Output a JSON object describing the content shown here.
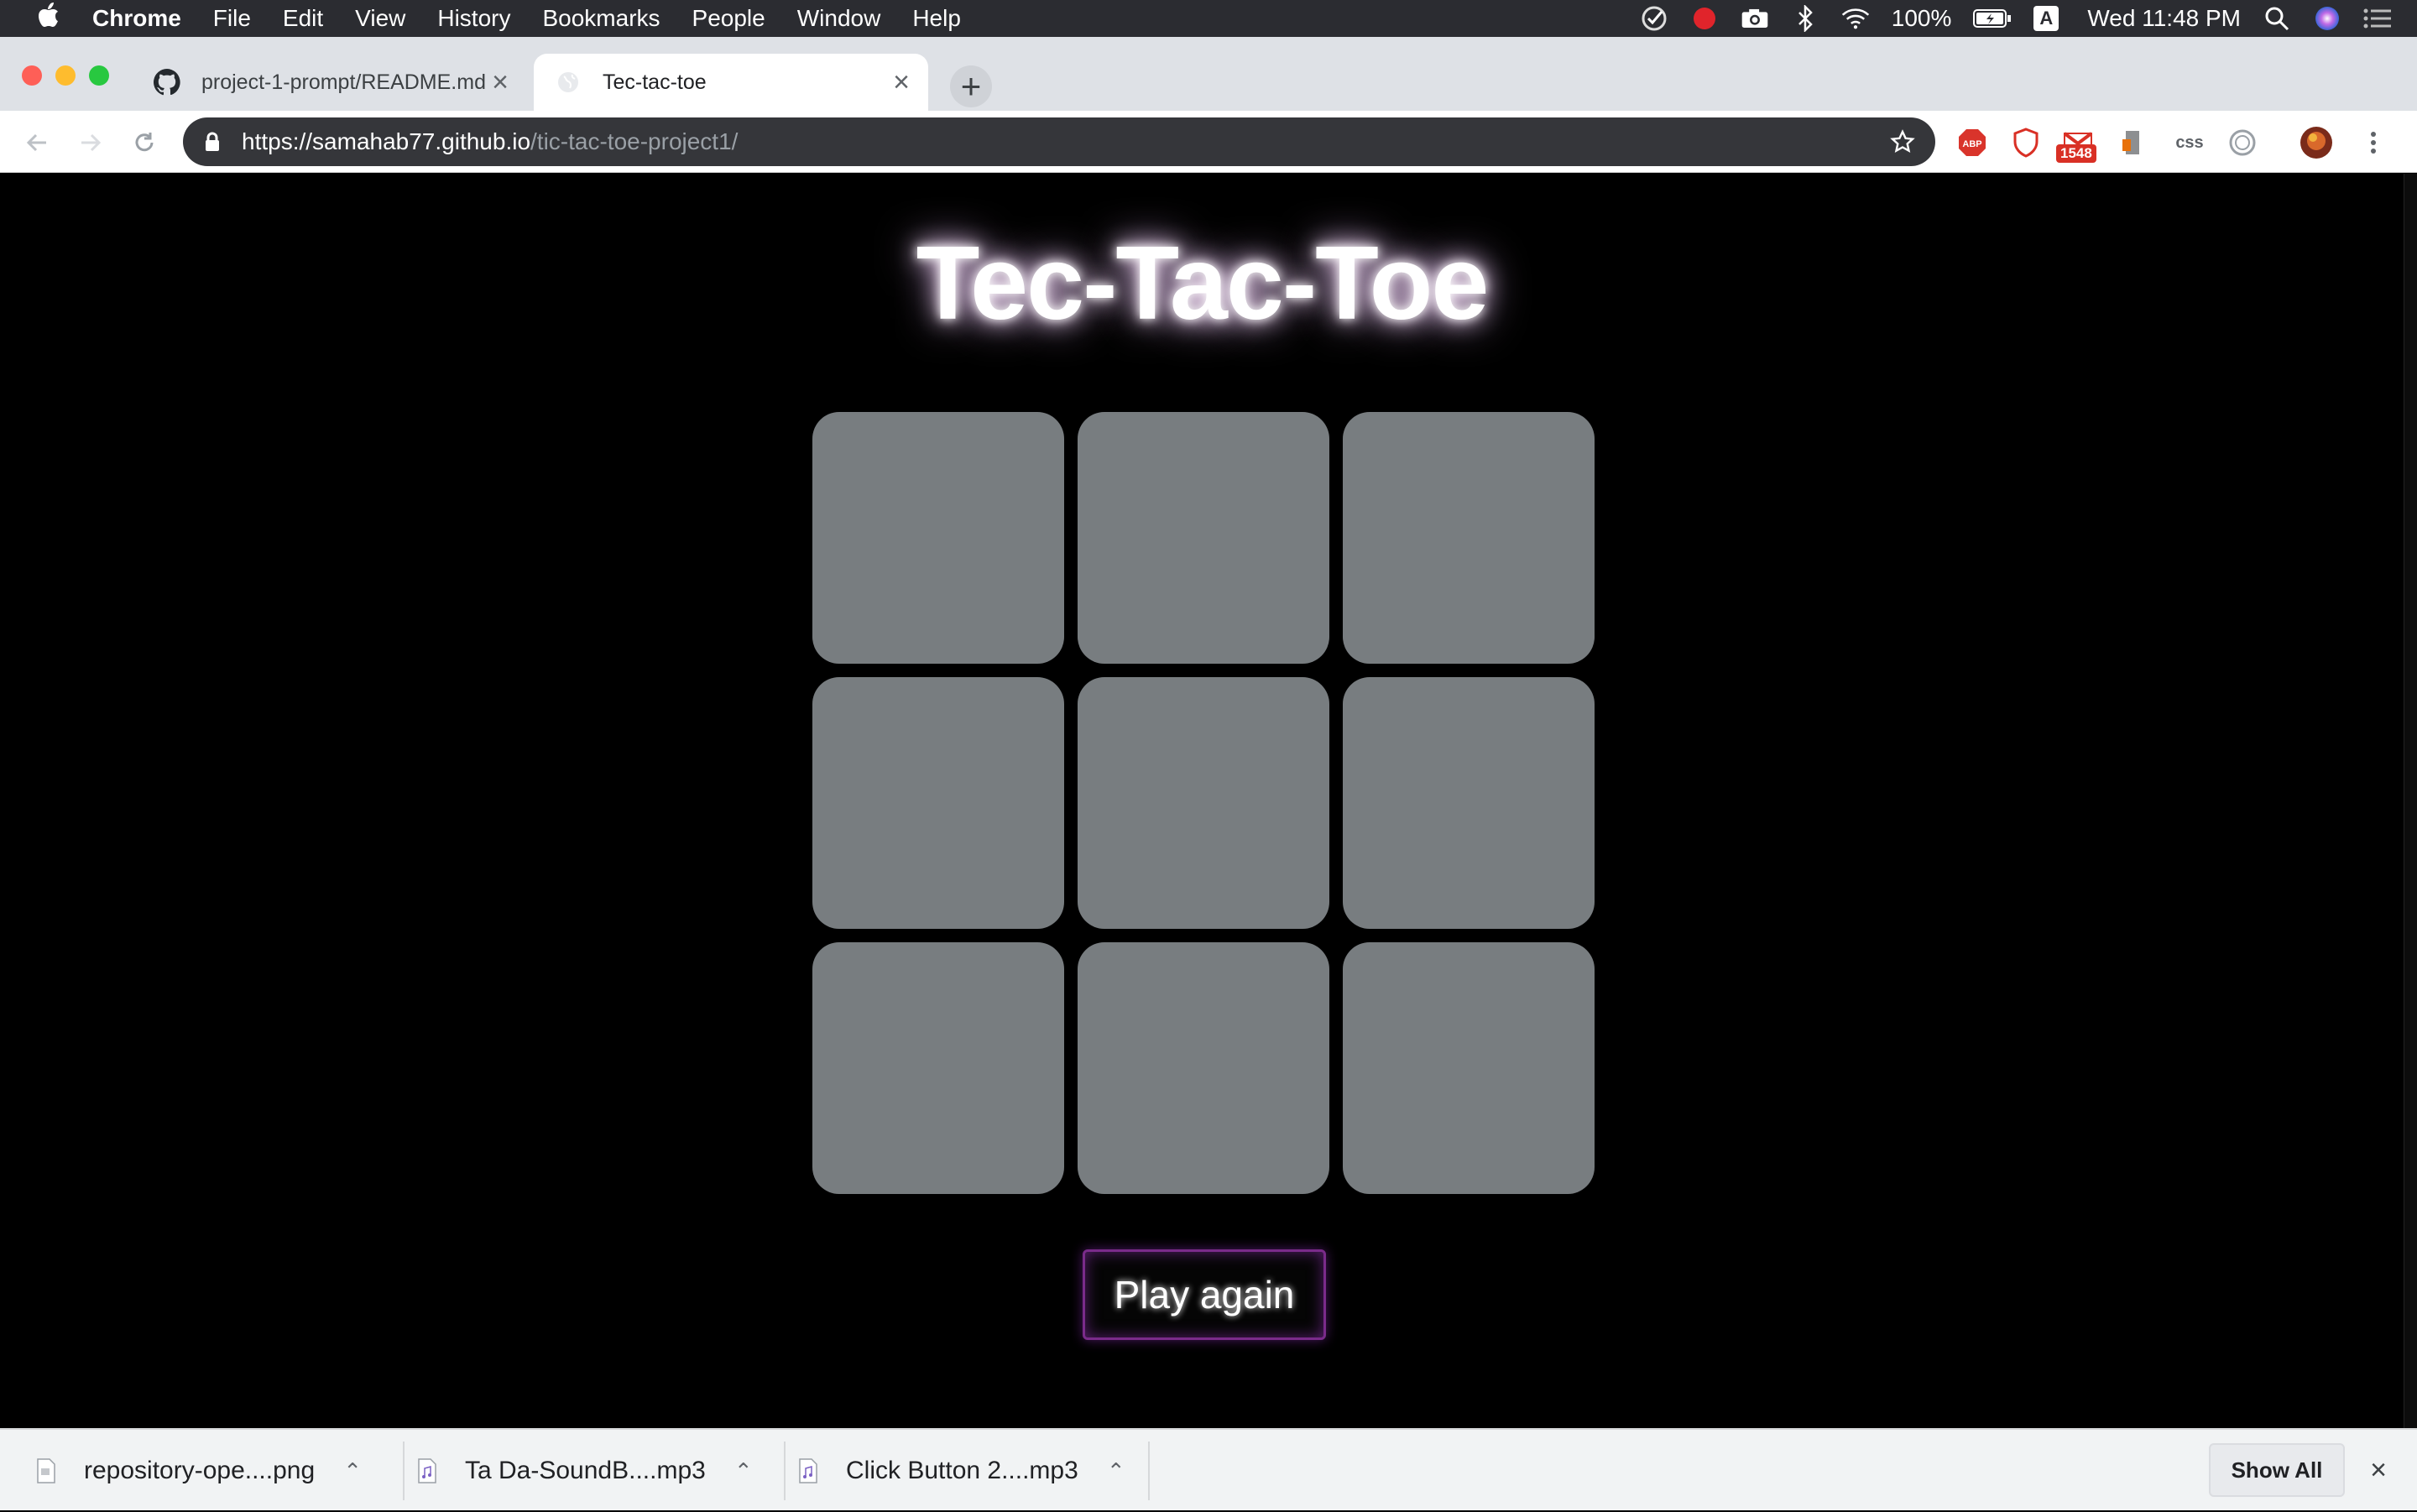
{
  "menubar": {
    "app_name": "Chrome",
    "items": [
      "File",
      "Edit",
      "View",
      "History",
      "Bookmarks",
      "People",
      "Window",
      "Help"
    ],
    "battery": "100%",
    "input_source": "A",
    "clock": "Wed 11:48 PM"
  },
  "tabs": [
    {
      "title": "project-1-prompt/README.md",
      "icon": "github-icon",
      "active": false
    },
    {
      "title": "Tec-tac-toe",
      "icon": "globe-icon",
      "active": true
    }
  ],
  "omnibox": {
    "url_host": "https://samahab77.github.io",
    "url_path": "/tic-tac-toe-project1/"
  },
  "extensions": {
    "abp_label": "ABP",
    "gmail_badge": "1548",
    "css_label": "css"
  },
  "game": {
    "title": "Tec-Tac-Toe",
    "cells": [
      "",
      "",
      "",
      "",
      "",
      "",
      "",
      "",
      ""
    ],
    "play_again_label": "Play again"
  },
  "downloads": {
    "items": [
      {
        "name": "repository-ope....png"
      },
      {
        "name": "Ta Da-SoundB....mp3"
      },
      {
        "name": "Click Button 2....mp3"
      }
    ],
    "show_all_label": "Show All"
  },
  "colors": {
    "page_bg": "#000000",
    "cell": "#787d80",
    "button_border": "#7a2b8a",
    "omnibox_bg": "#35363a"
  }
}
